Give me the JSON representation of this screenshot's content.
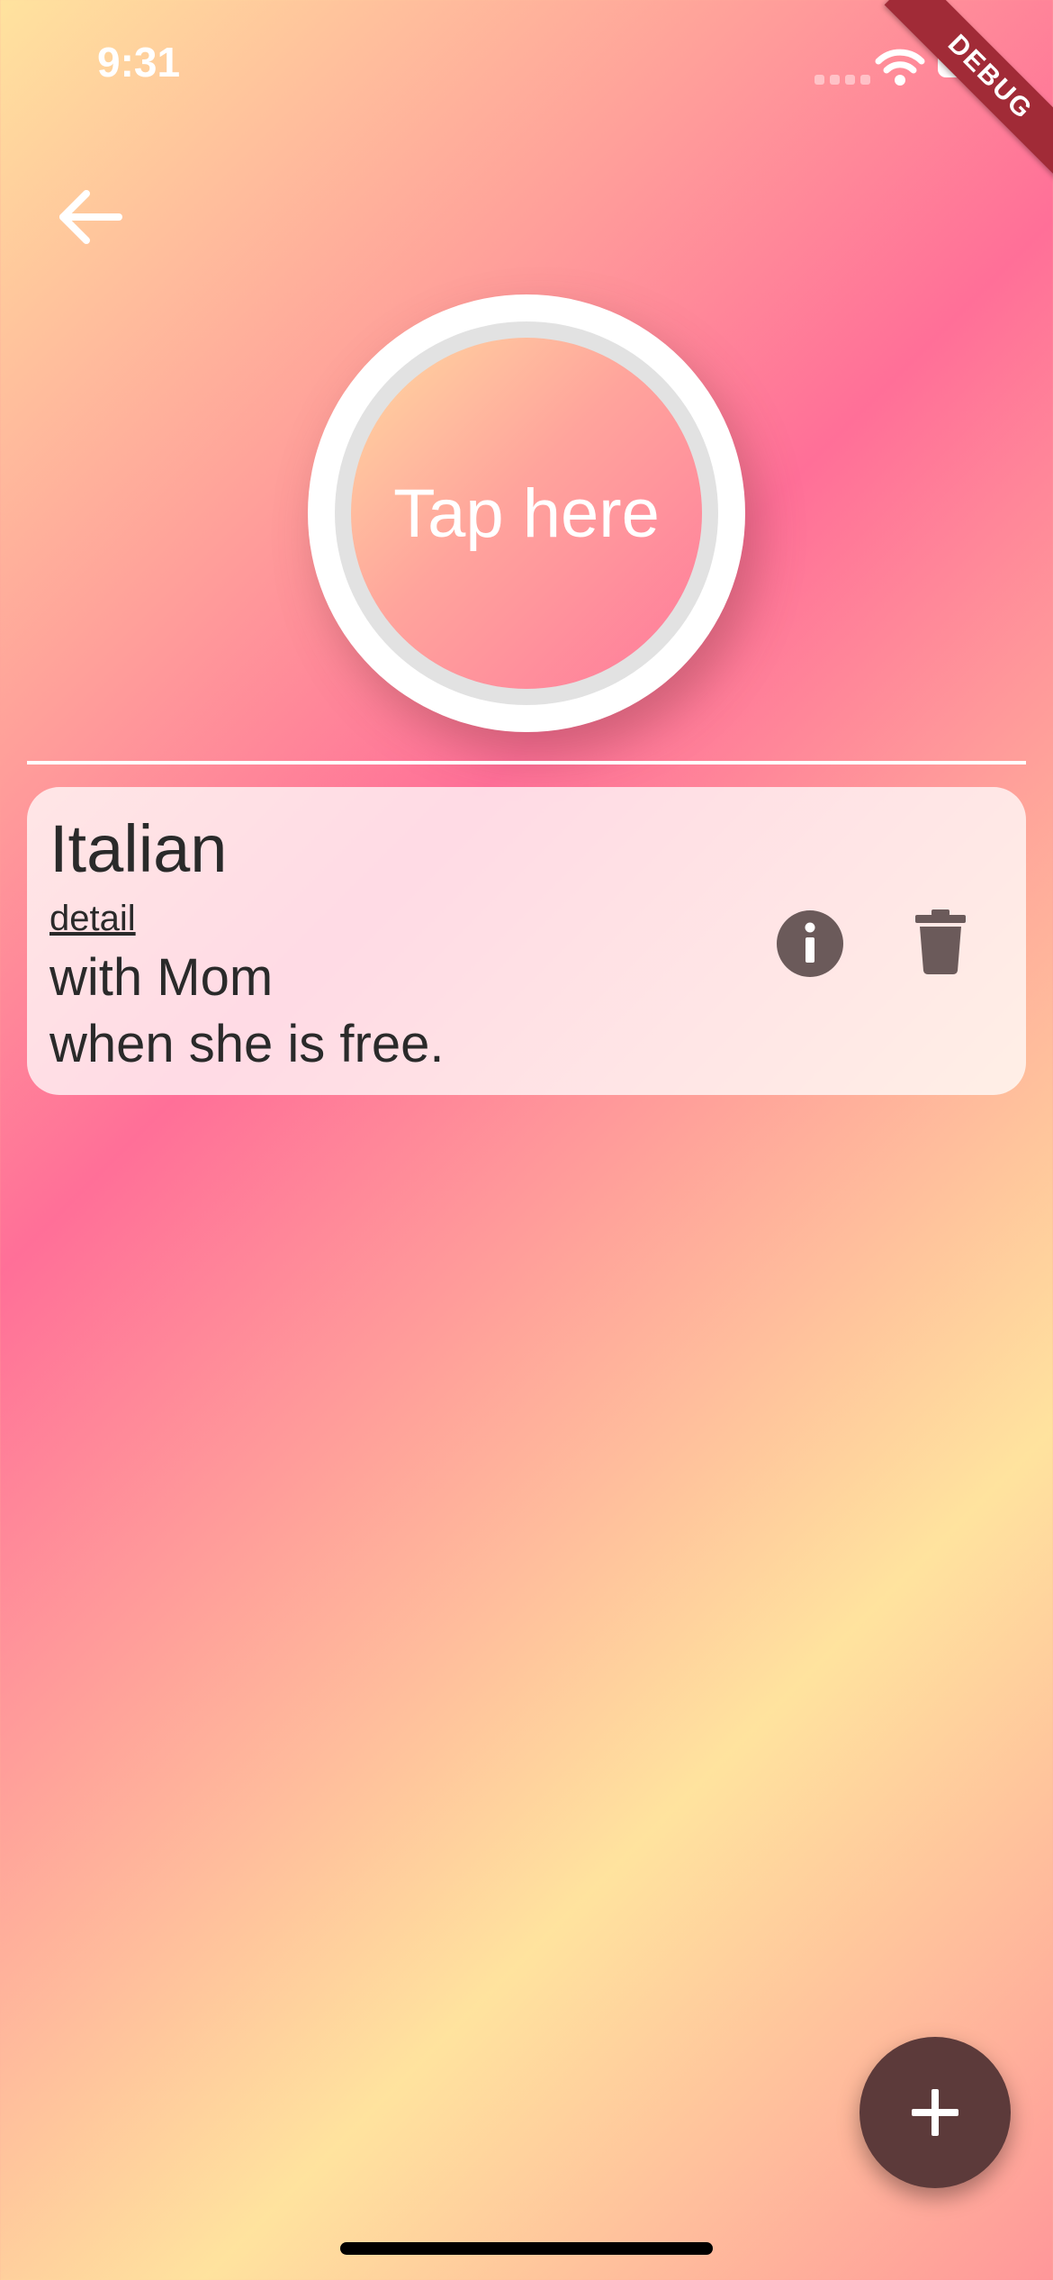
{
  "status_bar": {
    "time": "9:31",
    "debug_label": "DEBUG"
  },
  "header": {
    "back_icon": "arrow-back-icon"
  },
  "tap_button": {
    "label": "Tap here"
  },
  "items": [
    {
      "title": "Italian",
      "detail_link": "detail",
      "line1": "with Mom",
      "line2": "when she is free.",
      "info_icon": "info-icon",
      "delete_icon": "trash-icon"
    }
  ],
  "fab": {
    "icon": "plus-icon"
  },
  "colors": {
    "gradient_yellow": "#ffe39e",
    "gradient_pink": "#ff6f98",
    "fab": "#5c3a3a",
    "debug_banner": "#a12b37"
  }
}
